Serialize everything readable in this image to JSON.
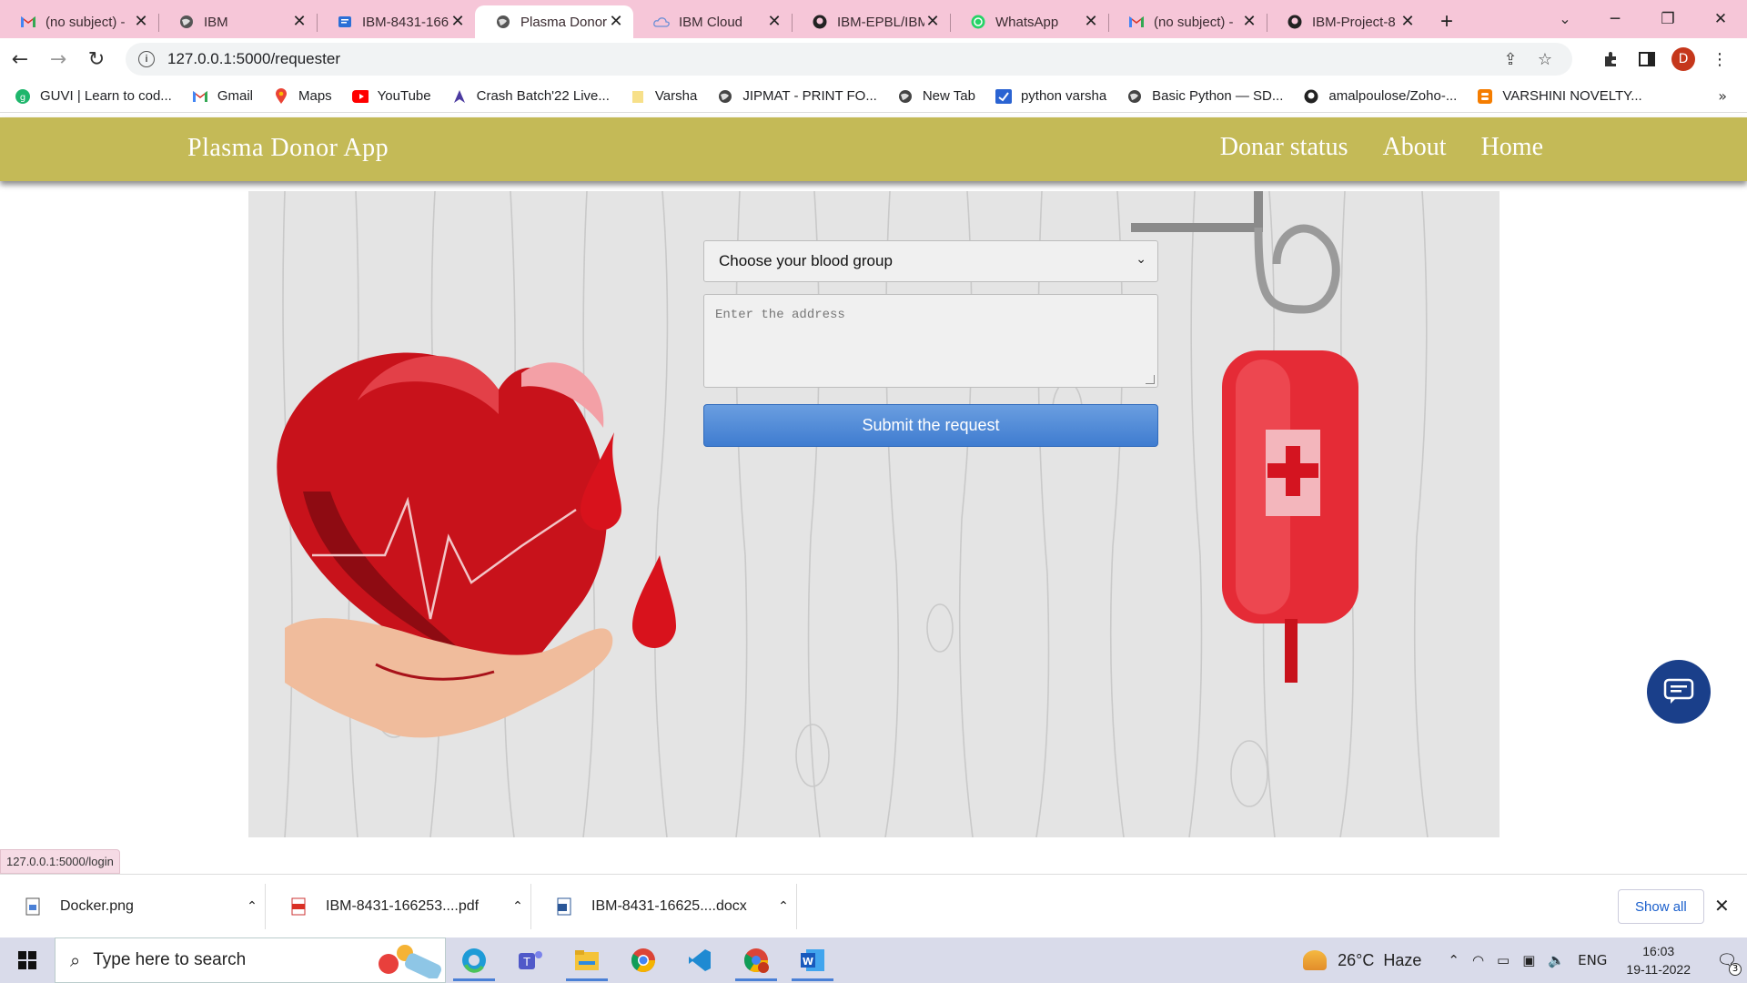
{
  "browser": {
    "tabs": [
      {
        "title": "(no subject) -",
        "icon": "gmail-icon"
      },
      {
        "title": "IBM",
        "icon": "globe-icon"
      },
      {
        "title": "IBM-8431-166",
        "icon": "doc-icon"
      },
      {
        "title": "Plasma Donor",
        "icon": "globe-icon",
        "active": true
      },
      {
        "title": "IBM Cloud",
        "icon": "cloud-icon"
      },
      {
        "title": "IBM-EPBL/IBM",
        "icon": "github-icon"
      },
      {
        "title": "WhatsApp",
        "icon": "whatsapp-icon"
      },
      {
        "title": "(no subject) -",
        "icon": "gmail-icon"
      },
      {
        "title": "IBM-Project-8",
        "icon": "github-icon"
      }
    ],
    "url": "127.0.0.1:5000/requester",
    "profile_initial": "D",
    "bookmarks": [
      {
        "label": "GUVI | Learn to cod...",
        "icon": "guvi-icon"
      },
      {
        "label": "Gmail",
        "icon": "gmail-icon"
      },
      {
        "label": "Maps",
        "icon": "maps-icon"
      },
      {
        "label": "YouTube",
        "icon": "youtube-icon"
      },
      {
        "label": "Crash Batch'22 Live...",
        "icon": "crash-icon"
      },
      {
        "label": "Varsha",
        "icon": "folder-icon"
      },
      {
        "label": "JIPMAT - PRINT FO...",
        "icon": "globe-icon"
      },
      {
        "label": "New Tab",
        "icon": "globe-icon"
      },
      {
        "label": "python varsha",
        "icon": "python-icon"
      },
      {
        "label": "Basic Python — SD...",
        "icon": "globe-icon"
      },
      {
        "label": "amalpoulose/Zoho-...",
        "icon": "github-icon"
      },
      {
        "label": "VARSHINI NOVELTY...",
        "icon": "blogger-icon"
      }
    ]
  },
  "app": {
    "brand": "Plasma Donor App",
    "nav": [
      "Donar status",
      "About",
      "Home"
    ],
    "form": {
      "blood_group_selected": "Choose your blood group",
      "address_placeholder": "Enter the address",
      "submit_label": "Submit the request"
    }
  },
  "status_url": "127.0.0.1:5000/login",
  "downloads": [
    {
      "name": "Docker.png",
      "type": "image"
    },
    {
      "name": "IBM-8431-166253....pdf",
      "type": "pdf"
    },
    {
      "name": "IBM-8431-16625....docx",
      "type": "word"
    }
  ],
  "downloads_show_all": "Show all",
  "taskbar": {
    "search_placeholder": "Type here to search",
    "weather_temp": "26°C",
    "weather_text": "Haze",
    "language": "ENG",
    "time": "16:03",
    "date": "19-11-2022",
    "notifications": "3"
  },
  "colors": {
    "tabbar": "#f6c6d8",
    "app_nav": "#c4ba57",
    "submit": "#4a86d8",
    "chat_button": "#1a3f8a"
  }
}
